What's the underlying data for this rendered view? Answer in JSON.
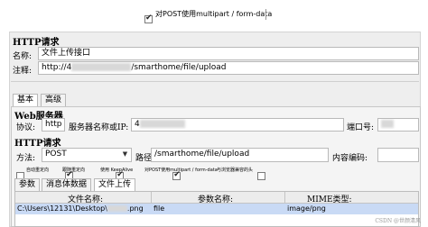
{
  "top_option": {
    "label": "对POST使用multipart / form-data",
    "checked": true
  },
  "http_request_header": "HTTP请求",
  "name_label": "名称:",
  "name_value": "文件上传接口",
  "comment_label": "注释:",
  "comment_value": "http://4",
  "comment_value_suffix": "/smarthome/file/upload",
  "tabs": [
    {
      "label": "基本",
      "active": true
    },
    {
      "label": "高级",
      "active": false
    }
  ],
  "web_server_section": "Web服务器",
  "protocol_label": "协议:",
  "protocol_value": "http",
  "server_label": "服务器名称或IP:",
  "server_value": "4",
  "port_label": "端口号:",
  "http_section": "HTTP请求",
  "method_label": "方法:",
  "method_value": "POST",
  "path_label": "路径:",
  "path_value": "/smarthome/file/upload",
  "encoding_label": "内容编码:",
  "encoding_value": "",
  "options": [
    {
      "label": "自动重定向",
      "checked": false
    },
    {
      "label": "跟随重定向",
      "checked": true
    },
    {
      "label": "使用 KeepAlive",
      "checked": true
    },
    {
      "label": "对POST使用multipart / form-data",
      "checked": true
    },
    {
      "label": "与浏览器兼容的头",
      "checked": false
    }
  ],
  "sub_tabs": [
    {
      "label": "参数",
      "active": false
    },
    {
      "label": "消息体数据",
      "active": false
    },
    {
      "label": "文件上传",
      "active": true
    }
  ],
  "file_table": {
    "columns": [
      "文件名称:",
      "参数名称:",
      "MIME类型:"
    ],
    "rows": [
      {
        "file": "C:\\Users\\12131\\Desktop\\",
        "file_suffix": ".png",
        "param": "file",
        "mime": "image/png"
      }
    ]
  },
  "watermark": "CSDN @世颜清风"
}
